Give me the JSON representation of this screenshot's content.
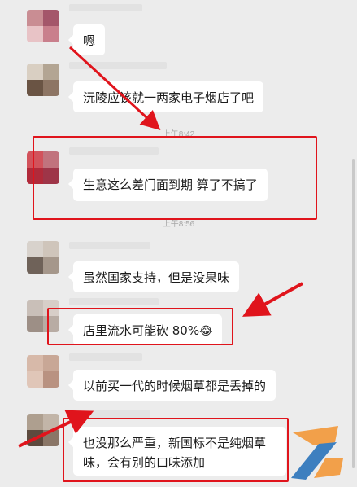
{
  "messages": [
    {
      "text": "嗯"
    },
    {
      "text": "沅陵应该就一两家电子烟店了吧"
    },
    {
      "text": "生意这么差门面到期  算了不搞了"
    },
    {
      "text": "虽然国家支持，但是没果味"
    },
    {
      "text": "店里流水可能砍 80%",
      "emoji": "😂"
    },
    {
      "text": "以前买一代的时候烟草都是丢掉的"
    },
    {
      "text": "也没那么严重，新国标不是纯烟草味，会有别的口味添加"
    }
  ],
  "timestamps": [
    "上午8:42",
    "上午8:56"
  ],
  "colors": {
    "annotation": "#e0141c",
    "bubble": "#ffffff",
    "background": "#ececec"
  }
}
